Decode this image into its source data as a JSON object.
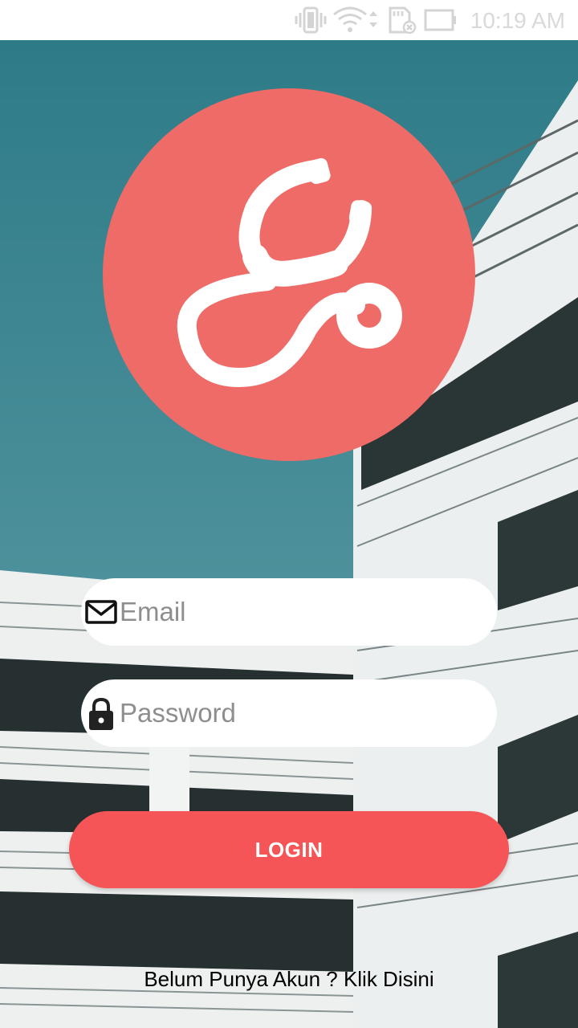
{
  "status_bar": {
    "time": "10:19 AM",
    "icons": [
      "vibrate-icon",
      "wifi-icon",
      "sd-card-icon",
      "battery-icon"
    ]
  },
  "login": {
    "email_placeholder": "Email",
    "email_value": "",
    "email_icon": "mail-icon",
    "password_placeholder": "Password",
    "password_value": "",
    "password_icon": "lock-icon",
    "login_label": "LOGIN",
    "register_text": "Belum Punya Akun ? Klik Disini"
  },
  "logo": {
    "icon": "stethoscope-icon"
  },
  "colors": {
    "logo_circle": "#ef6b67",
    "login_button": "#f65557",
    "sky_top": "#2e7b88",
    "sky_bottom": "#66a3ab"
  }
}
